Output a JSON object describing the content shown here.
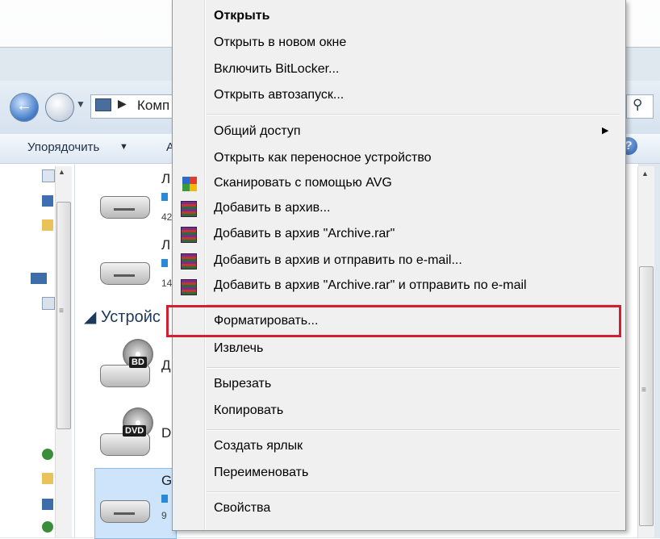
{
  "explorer": {
    "address_text": "Комп",
    "toolbar": {
      "organize_label": "Упорядочить",
      "organize_caret": "▼",
      "truncated_label": "А"
    },
    "section_devices": "◢ Устройс",
    "drives": [
      {
        "name": "Л",
        "info": "42"
      },
      {
        "name": "Л",
        "info": "14"
      },
      {
        "name": "Д",
        "badge": "BD"
      },
      {
        "name": "D",
        "badge": "DVD"
      },
      {
        "name": "G",
        "info": "9"
      }
    ]
  },
  "context_menu": {
    "items": [
      {
        "label": "Открыть",
        "bold": true
      },
      {
        "label": "Открыть в новом окне"
      },
      {
        "label": "Включить BitLocker..."
      },
      {
        "label": "Открыть автозапуск..."
      },
      {
        "label": "Общий доступ",
        "submenu": true
      },
      {
        "label": "Открыть как переносное устройство"
      },
      {
        "label": "Сканировать с помощью AVG",
        "icon": "avg-icon"
      },
      {
        "label": "Добавить в архив...",
        "icon": "winrar-icon"
      },
      {
        "label": "Добавить в архив \"Archive.rar\"",
        "icon": "winrar-icon"
      },
      {
        "label": "Добавить в архив и отправить по e-mail...",
        "icon": "winrar-icon"
      },
      {
        "label": "Добавить в архив \"Archive.rar\" и отправить по e-mail",
        "icon": "winrar-icon"
      },
      {
        "label": "Форматировать...",
        "highlighted": true
      },
      {
        "label": "Извлечь"
      },
      {
        "label": "Вырезать"
      },
      {
        "label": "Копировать"
      },
      {
        "label": "Создать ярлык"
      },
      {
        "label": "Переименовать"
      },
      {
        "label": "Свойства"
      }
    ],
    "submenu_arrow": "▶"
  },
  "colors": {
    "highlight_border": "#d32030",
    "menu_bg": "#f0f0f0"
  }
}
